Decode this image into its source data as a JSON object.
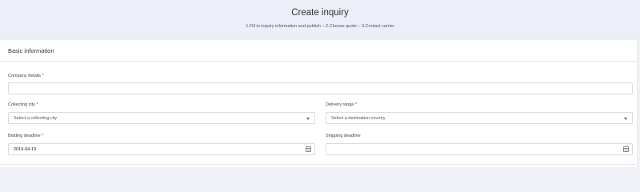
{
  "header": {
    "title": "Create inquiry",
    "steps": "1.Fill in inquiry information and publish – 2.Choose quote – 3.Contact carrier"
  },
  "section": {
    "title": "Basic information"
  },
  "fields": {
    "company_details": {
      "label": "Company details",
      "required": "*",
      "value": ""
    },
    "collecting_city": {
      "label": "Collecting city",
      "required": "*",
      "placeholder": "Select a collecting city"
    },
    "delivery_range": {
      "label": "Delivery range",
      "required": "*",
      "placeholder": "Select a destination country"
    },
    "bidding_deadline": {
      "label": "Bidding deadline",
      "required": "*",
      "value": "2019-04-19"
    },
    "shipping_deadline": {
      "label": "Shipping deadline",
      "value": ""
    }
  },
  "icons": {
    "dropdown": "chevron-down-icon",
    "date": "calendar-icon"
  },
  "colors": {
    "header_bg": "#eceef8",
    "page_bg": "#f0f2f8",
    "required": "#e02020",
    "border": "#d9dbe0"
  }
}
